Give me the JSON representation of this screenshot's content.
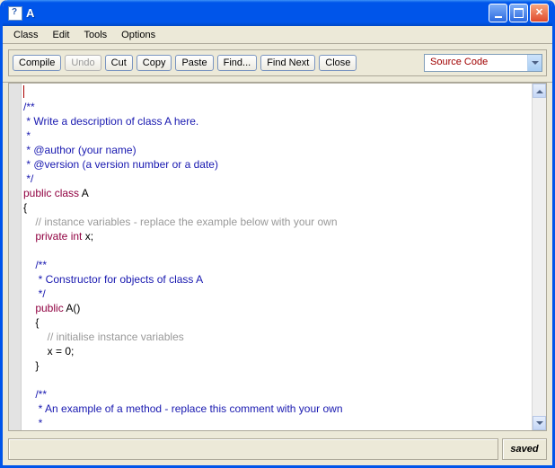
{
  "window": {
    "title": "A"
  },
  "menubar": {
    "items": [
      "Class",
      "Edit",
      "Tools",
      "Options"
    ]
  },
  "toolbar": {
    "compile": "Compile",
    "undo": "Undo",
    "cut": "Cut",
    "copy": "Copy",
    "paste": "Paste",
    "find": "Find...",
    "findnext": "Find Next",
    "close": "Close",
    "viewselect": "Source Code"
  },
  "code": {
    "l1": "",
    "l2": "/**",
    "l3": " * Write a description of class A here.",
    "l4": " * ",
    "l5": " * @author (your name) ",
    "l6": " * @version (a version number or a date)",
    "l7": " */",
    "l8a": "public",
    "l8b": " class",
    "l8c": " A",
    "l9": "{",
    "l10": "    // instance variables - replace the example below with your own",
    "l11a": "    private",
    "l11b": " int",
    "l11c": " x;",
    "l12": "",
    "l13": "    /**",
    "l14": "     * Constructor for objects of class A",
    "l15": "     */",
    "l16a": "    public",
    "l16b": " A()",
    "l17": "    {",
    "l18": "        // initialise instance variables",
    "l19": "        x = 0;",
    "l20": "    }",
    "l21": "",
    "l22": "    /**",
    "l23": "     * An example of a method - replace this comment with your own",
    "l24": "     * "
  },
  "status": {
    "saved": "saved"
  }
}
